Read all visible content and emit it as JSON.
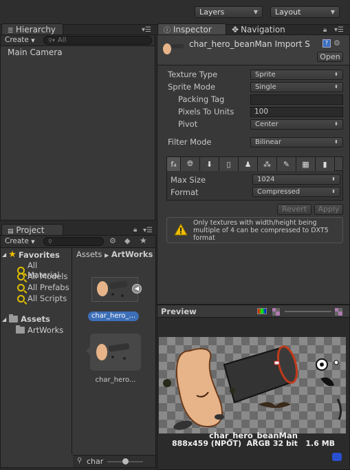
{
  "top_bar": {
    "layers_label": "Layers",
    "layout_label": "Layout"
  },
  "hierarchy": {
    "tab_label": "Hierarchy",
    "create_label": "Create",
    "search_placeholder": "All",
    "items": [
      "Main Camera"
    ]
  },
  "project": {
    "tab_label": "Project",
    "create_label": "Create",
    "favorites_label": "Favorites",
    "favorites": [
      "All Material",
      "All Models",
      "All Prefabs",
      "All Scripts"
    ],
    "assets_label": "Assets",
    "asset_folders": [
      "ArtWorks"
    ],
    "breadcrumb": {
      "root": "Assets",
      "current": "ArtWorks"
    },
    "items": [
      {
        "label": "char_hero_..."
      },
      {
        "label": "char_hero..."
      }
    ],
    "search_value": "char"
  },
  "inspector": {
    "tab_label": "Inspector",
    "navigation_tab_label": "Navigation",
    "title": "char_hero_beanMan Import S",
    "open_label": "Open",
    "texture_type": {
      "label": "Texture Type",
      "value": "Sprite"
    },
    "sprite_mode": {
      "label": "Sprite Mode",
      "value": "Single"
    },
    "packing_tag": {
      "label": "Packing Tag",
      "value": ""
    },
    "pixels_to_units": {
      "label": "Pixels To Units",
      "value": "100"
    },
    "pivot": {
      "label": "Pivot",
      "value": "Center"
    },
    "filter_mode": {
      "label": "Filter Mode",
      "value": "Bilinear"
    },
    "max_size": {
      "label": "Max Size",
      "value": "1024"
    },
    "format": {
      "label": "Format",
      "value": "Compressed"
    },
    "revert_label": "Revert",
    "apply_label": "Apply",
    "warning_text": "Only textures with width/height being multiple of 4 can be compressed to DXT5 format"
  },
  "preview": {
    "label": "Preview",
    "name": "char_hero_beanMan",
    "info": "888x459 (NPOT)  ARGB 32 bit   1.6 MB"
  },
  "icons": [
    "dropdown-arrow",
    "lock-icon",
    "menu-icon",
    "search-icon",
    "gear-icon",
    "star-icon",
    "folder-icon",
    "warning-icon",
    "play-icon",
    "platform-icons"
  ]
}
